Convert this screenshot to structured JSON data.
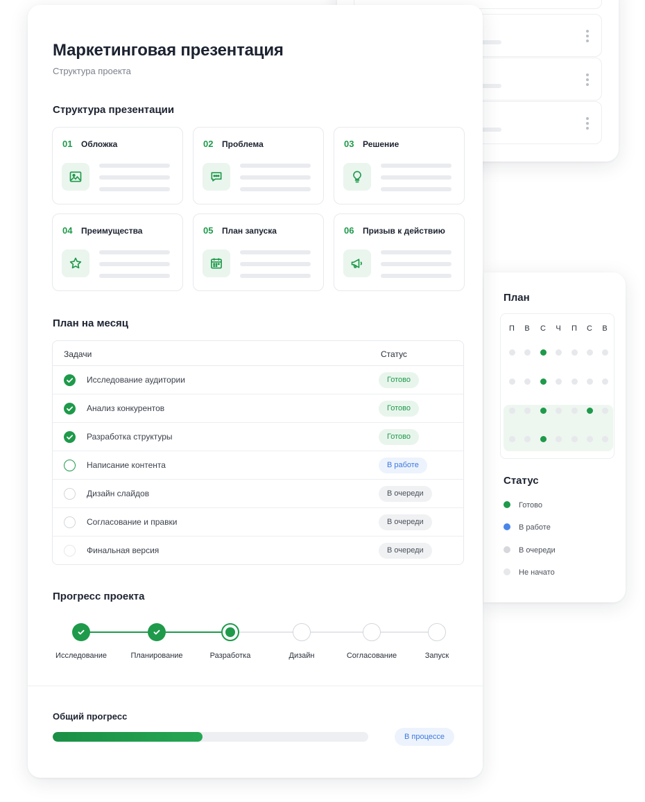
{
  "header": {
    "title": "Маркетинговая презентация",
    "subtitle": "Структура проекта"
  },
  "structure": {
    "title": "Структура презентации",
    "tiles": [
      {
        "num": "01",
        "label": "Обложка",
        "icon": "image-icon"
      },
      {
        "num": "02",
        "label": "Проблема",
        "icon": "chat-icon"
      },
      {
        "num": "03",
        "label": "Решение",
        "icon": "lightbulb-icon"
      },
      {
        "num": "04",
        "label": "Преимущества",
        "icon": "star-icon"
      },
      {
        "num": "05",
        "label": "План запуска",
        "icon": "calendar-icon"
      },
      {
        "num": "06",
        "label": "Призыв к действию",
        "icon": "megaphone-icon"
      }
    ]
  },
  "month_plan": {
    "title": "План на месяц",
    "col_tasks": "Задачи",
    "col_status": "Статус",
    "rows": [
      {
        "task": "Исследование аудитории",
        "status": "Готово",
        "state": "done"
      },
      {
        "task": "Анализ конкурентов",
        "status": "Готово",
        "state": "done"
      },
      {
        "task": "Разработка структуры",
        "status": "Готово",
        "state": "done"
      },
      {
        "task": "Написание контента",
        "status": "В работе",
        "state": "work"
      },
      {
        "task": "Дизайн слайдов",
        "status": "В очереди",
        "state": "queue"
      },
      {
        "task": "Согласование и правки",
        "status": "В очереди",
        "state": "queue"
      },
      {
        "task": "Финальная версия",
        "status": "В очереди",
        "state": "queue"
      }
    ]
  },
  "progress": {
    "title": "Прогресс проекта",
    "steps": [
      {
        "label": "Исследование",
        "state": "done"
      },
      {
        "label": "Планирование",
        "state": "done"
      },
      {
        "label": "Разработка",
        "state": "current"
      },
      {
        "label": "Дизайн",
        "state": "todo"
      },
      {
        "label": "Согласование",
        "state": "todo"
      },
      {
        "label": "Запуск",
        "state": "todo"
      }
    ]
  },
  "overall": {
    "title": "Общий прогресс",
    "fraction": 0.475,
    "status": "В процессе"
  },
  "plan_panel": {
    "title": "План",
    "weekdays": [
      "П",
      "В",
      "С",
      "Ч",
      "П",
      "С",
      "В"
    ],
    "weeks_active": [
      [
        2
      ],
      [
        2
      ],
      [
        2,
        5
      ],
      [
        2
      ]
    ],
    "status_title": "Статус",
    "legend": [
      {
        "label": "Готово",
        "color": "#1e9a4a"
      },
      {
        "label": "В работе",
        "color": "#4a86e8"
      },
      {
        "label": "В очереди",
        "color": "#d6d8dc"
      },
      {
        "label": "Не начато",
        "color": "#e6e8eb"
      }
    ]
  },
  "files": [
    {
      "icon": "doc-blue-icon",
      "color": "#4285f4"
    },
    {
      "icon": "doc-yellow-icon",
      "color": "#fbbc04"
    },
    {
      "icon": "doc-gray-icon",
      "color": "#c9ccd1"
    }
  ],
  "colors": {
    "accent": "#1e9a4a",
    "info": "#3b78e0"
  }
}
